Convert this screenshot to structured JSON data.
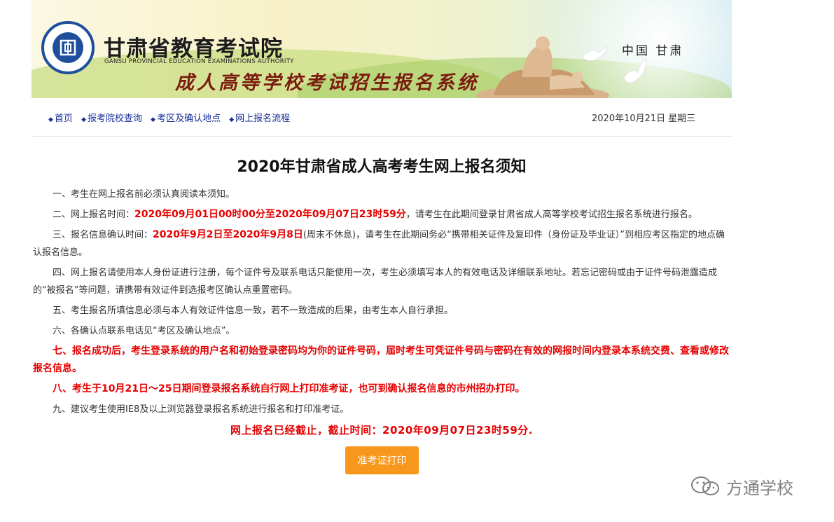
{
  "header": {
    "org_name_cn": "甘肃省教育考试院",
    "org_name_en": "GANSU PROVINCIAL EDUCATION EXAMINATIONS AUTHORITY",
    "system_title": "成人高等学校考试招生报名系统",
    "region": "中国 甘肃",
    "logo_ring_text": "甘肃省教育考试院 GANSU PROVINCIAL EDUCATION EXAMINATIONS AUTHORITY"
  },
  "nav": {
    "items": [
      {
        "label": "首页"
      },
      {
        "label": "报考院校查询"
      },
      {
        "label": "考区及确认地点"
      },
      {
        "label": "网上报名流程"
      }
    ]
  },
  "date_text": "2020年10月21日 星期三",
  "notice": {
    "title": "2020年甘肃省成人高考考生网上报名须知",
    "item1": "一、考生在网上报名前必须认真阅读本须知。",
    "item2_pre": "二、网上报名时间：",
    "item2_red": "2020年09月01日00时00分至2020年09月07日23时59分",
    "item2_post": "，请考生在此期间登录甘肃省成人高等学校考试招生报名系统进行报名。",
    "item3_pre": "三、报名信息确认时间：",
    "item3_red": "2020年9月2日至2020年9月8日",
    "item3_post": "(周末不休息)，请考生在此期间务必“携带相关证件及复印件（身份证及毕业证）”到相应考区指定的地点确认报名信息。",
    "item4": "四、网上报名请使用本人身份证进行注册，每个证件号及联系电话只能使用一次，考生必须填写本人的有效电话及详细联系地址。若忘记密码或由于证件号码泄露造成的“被报名”等问题，请携带有效证件到选报考区确认点重置密码。",
    "item5": "五、考生报名所填信息必须与本人有效证件信息一致，若不一致造成的后果，由考生本人自行承担。",
    "item6": "六、各确认点联系电话见“考区及确认地点”。",
    "item7": "七、报名成功后，考生登录系统的用户名和初始登录密码均为你的证件号码，届时考生可凭证件号码与密码在有效的网报时间内登录本系统交费、查看或修改报名信息。",
    "item8": "八、考生于10月21日～25日期间登录报名系统自行网上打印准考证，也可到确认报名信息的市州招办打印。",
    "item9": "九、建议考生使用IE8及以上浏览器登录报名系统进行报名和打印准考证。",
    "deadline": "网上报名已经截止，截止时间：2020年09月07日23时59分."
  },
  "print_button": "准考证打印",
  "watermark": "方通学校",
  "colors": {
    "accent_red": "#e60000",
    "nav_blue": "#1a2f9a",
    "button_orange": "#f7981d",
    "logo_blue": "#1f4f9c"
  }
}
